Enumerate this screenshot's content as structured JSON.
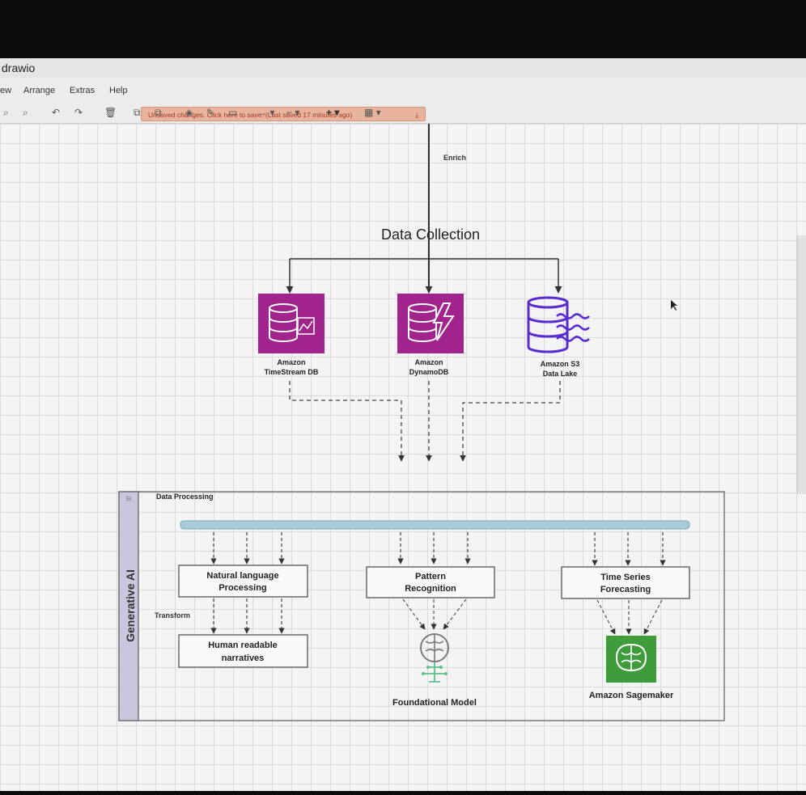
{
  "app": {
    "title": "drawio"
  },
  "menu": {
    "items": [
      "ew",
      "Arrange",
      "Extras",
      "Help"
    ]
  },
  "save_banner": "Unsaved changes. Click here to save. (Last saved 17 minutes ago)",
  "diagram": {
    "enrich_label": "Enrich",
    "collection_title": "Data Collection",
    "sources": {
      "timestream": [
        "Amazon",
        "TimeStream DB"
      ],
      "dynamodb": [
        "Amazon",
        "DynamoDB"
      ],
      "s3": [
        "Amazon S3",
        "Data Lake"
      ]
    },
    "group_side_label": "Generative AI",
    "group_title": "Data Processing",
    "boxes": {
      "nlp": [
        "Natural language",
        "Processing"
      ],
      "pattern": [
        "Pattern",
        "Recognition"
      ],
      "timeseries": [
        "Time Series",
        "Forecasting"
      ],
      "narratives": [
        "Human readable",
        "narratives"
      ]
    },
    "transform_label": "Transform",
    "foundational_model": "Foundational Model",
    "sagemaker": "Amazon Sagemaker"
  },
  "colors": {
    "aws_db_purple": "#a0248c",
    "s3_purple": "#5a2bd0",
    "sagemaker_green": "#3f9c3b",
    "bus_blue": "#a9ccd8",
    "group_header": "#c9c7dd"
  }
}
